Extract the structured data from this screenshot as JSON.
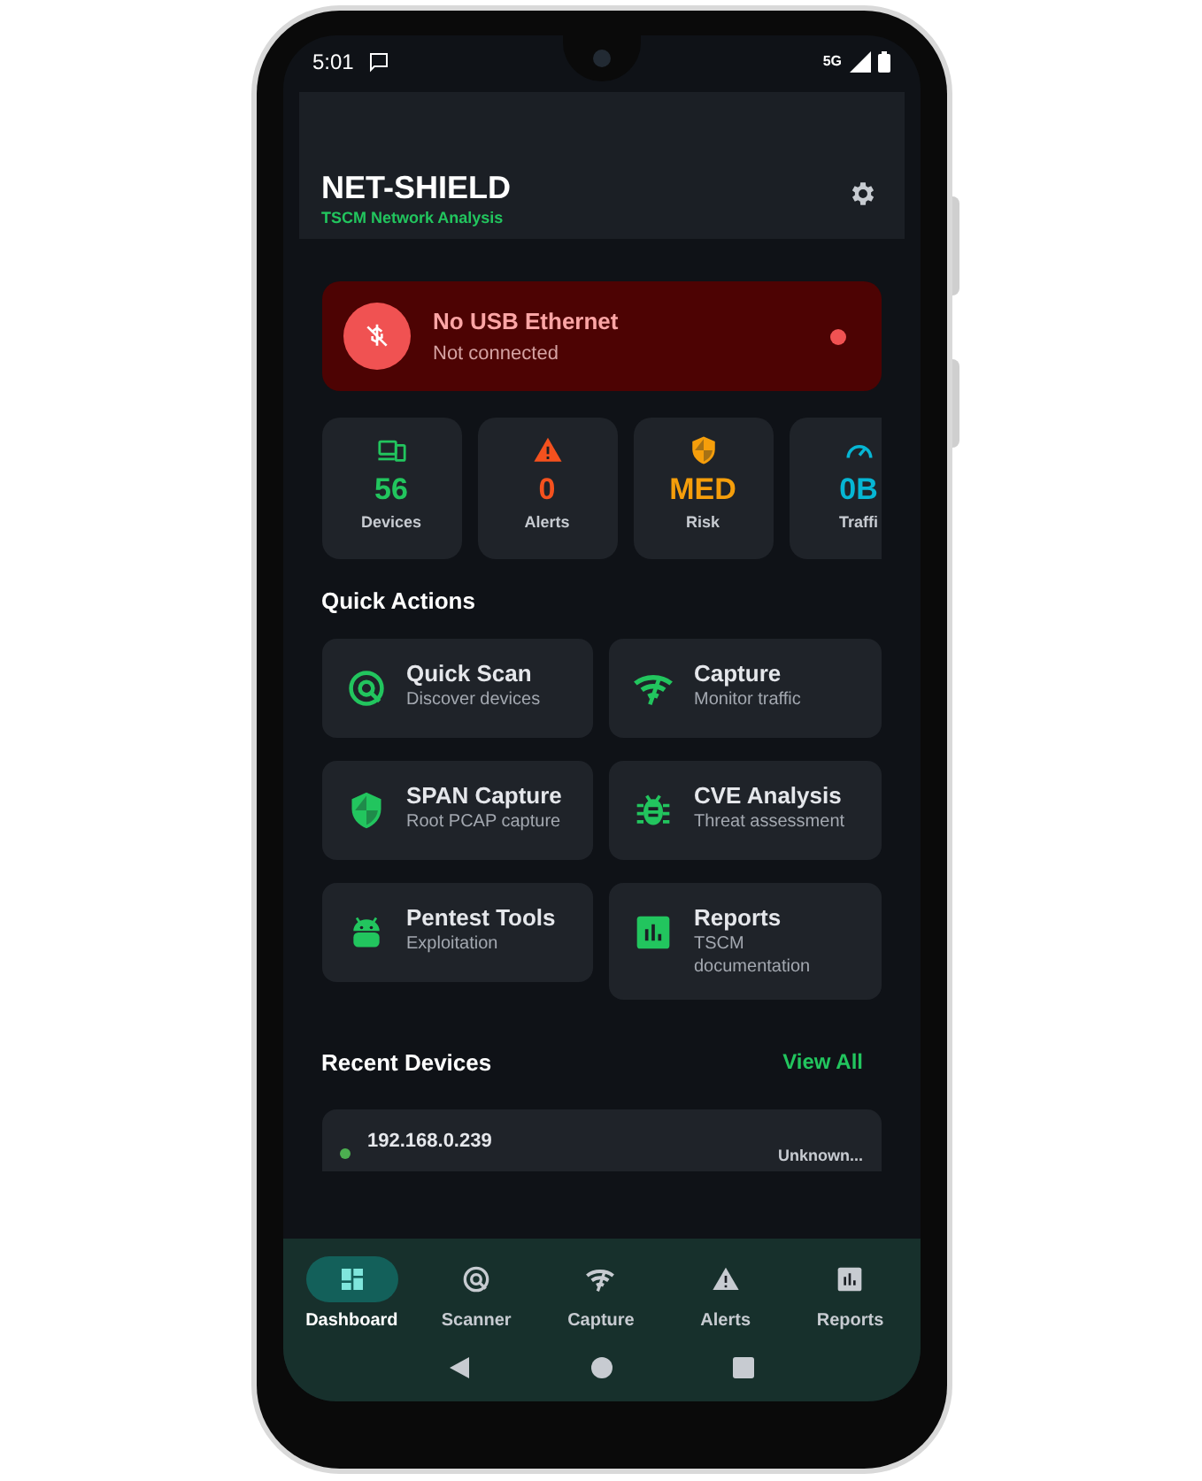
{
  "status_bar": {
    "time": "5:01",
    "network": "5G"
  },
  "header": {
    "title": "NET-SHIELD",
    "subtitle": "TSCM Network Analysis"
  },
  "connection": {
    "title": "No USB Ethernet",
    "subtitle": "Not connected",
    "connected": false
  },
  "stats": [
    {
      "kind": "devices",
      "value": "56",
      "label": "Devices",
      "color": "#22c55e"
    },
    {
      "kind": "warning",
      "value": "0",
      "label": "Alerts",
      "color": "#f4511e"
    },
    {
      "kind": "shield",
      "value": "MED",
      "label": "Risk",
      "color": "#f59e0b"
    },
    {
      "kind": "gauge",
      "value": "0B",
      "label": "Traffi",
      "color": "#06b6d4"
    }
  ],
  "quick_actions": {
    "title": "Quick Actions",
    "items": [
      {
        "kind": "radar",
        "title": "Quick Scan",
        "subtitle": "Discover devices"
      },
      {
        "kind": "wifi",
        "title": "Capture",
        "subtitle": "Monitor traffic"
      },
      {
        "kind": "shield",
        "title": "SPAN Capture",
        "subtitle": "Root PCAP capture"
      },
      {
        "kind": "bug",
        "title": "CVE Analysis",
        "subtitle": "Threat assessment"
      },
      {
        "kind": "android",
        "title": "Pentest Tools",
        "subtitle": "Exploitation"
      },
      {
        "kind": "chart",
        "title": "Reports",
        "subtitle": "TSCM documentation"
      }
    ]
  },
  "recent_devices": {
    "title": "Recent Devices",
    "link": "View All",
    "devices": [
      {
        "ip": "192.168.0.239",
        "vendor": "Unknown...",
        "online": true
      }
    ]
  },
  "bottom_nav": [
    {
      "kind": "dashboard",
      "label": "Dashboard",
      "selected": true
    },
    {
      "kind": "radar",
      "label": "Scanner",
      "selected": false
    },
    {
      "kind": "wifi",
      "label": "Capture",
      "selected": false
    },
    {
      "kind": "warning",
      "label": "Alerts",
      "selected": false
    },
    {
      "kind": "chart",
      "label": "Reports",
      "selected": false
    }
  ]
}
